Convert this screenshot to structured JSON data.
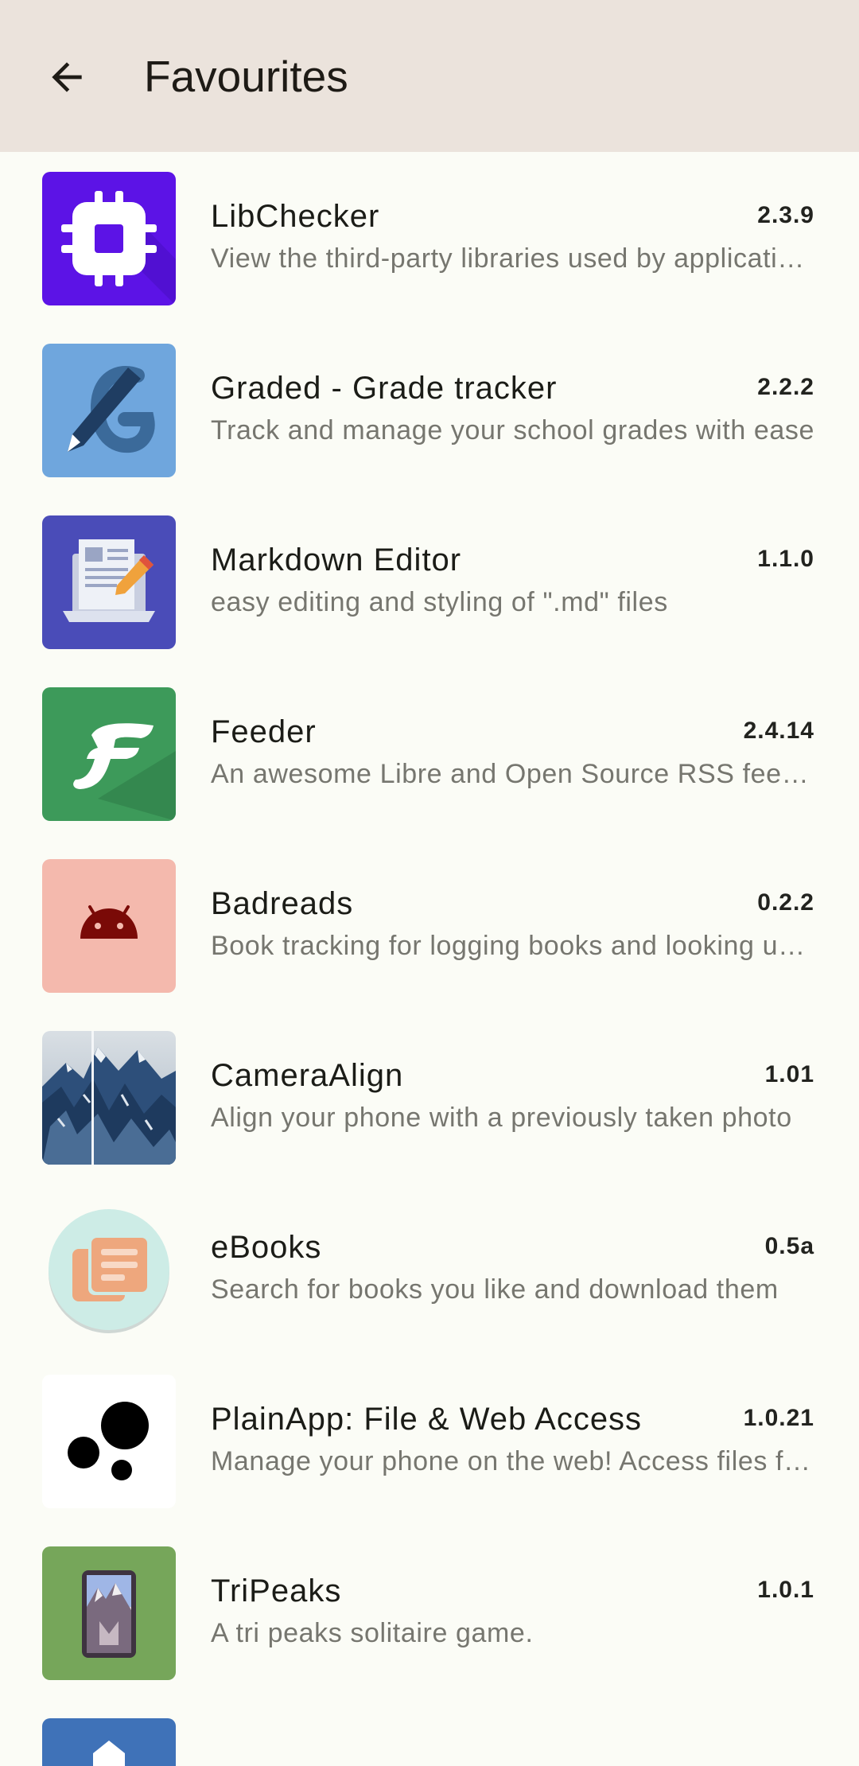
{
  "app_bar": {
    "title": "Favourites",
    "background": "#ebe3dc"
  },
  "apps": [
    {
      "name": "LibChecker",
      "version": "2.3.9",
      "summary": "View the third-party libraries used by applications in your device",
      "icon": "libchecker-chip-icon"
    },
    {
      "name": "Graded - Grade tracker",
      "version": "2.2.2",
      "summary": "Track and manage your school grades with ease",
      "icon": "graded-pen-icon"
    },
    {
      "name": "Markdown Editor",
      "version": "1.1.0",
      "summary": "easy editing and styling of \".md\" files",
      "icon": "markdown-editor-laptop-icon"
    },
    {
      "name": "Feeder",
      "version": "2.4.14",
      "summary": "An awesome Libre and Open Source RSS feed reader",
      "icon": "feeder-f-icon"
    },
    {
      "name": "Badreads",
      "version": "0.2.2",
      "summary": "Book tracking for logging books and looking up new ones",
      "icon": "badreads-android-icon"
    },
    {
      "name": "CameraAlign",
      "version": "1.01",
      "summary": "Align your phone with a previously taken photo",
      "icon": "cameraalign-mountain-icon"
    },
    {
      "name": "eBooks",
      "version": "0.5a",
      "summary": "Search for books you like and download them",
      "icon": "ebooks-pages-icon"
    },
    {
      "name": "PlainApp: File & Web Access",
      "version": "1.0.21",
      "summary": "Manage your phone on the web! Access files from your browser",
      "icon": "plainapp-dots-icon"
    },
    {
      "name": "TriPeaks",
      "version": "1.0.1",
      "summary": "A tri peaks solitaire game.",
      "icon": "tripeaks-card-icon"
    }
  ]
}
